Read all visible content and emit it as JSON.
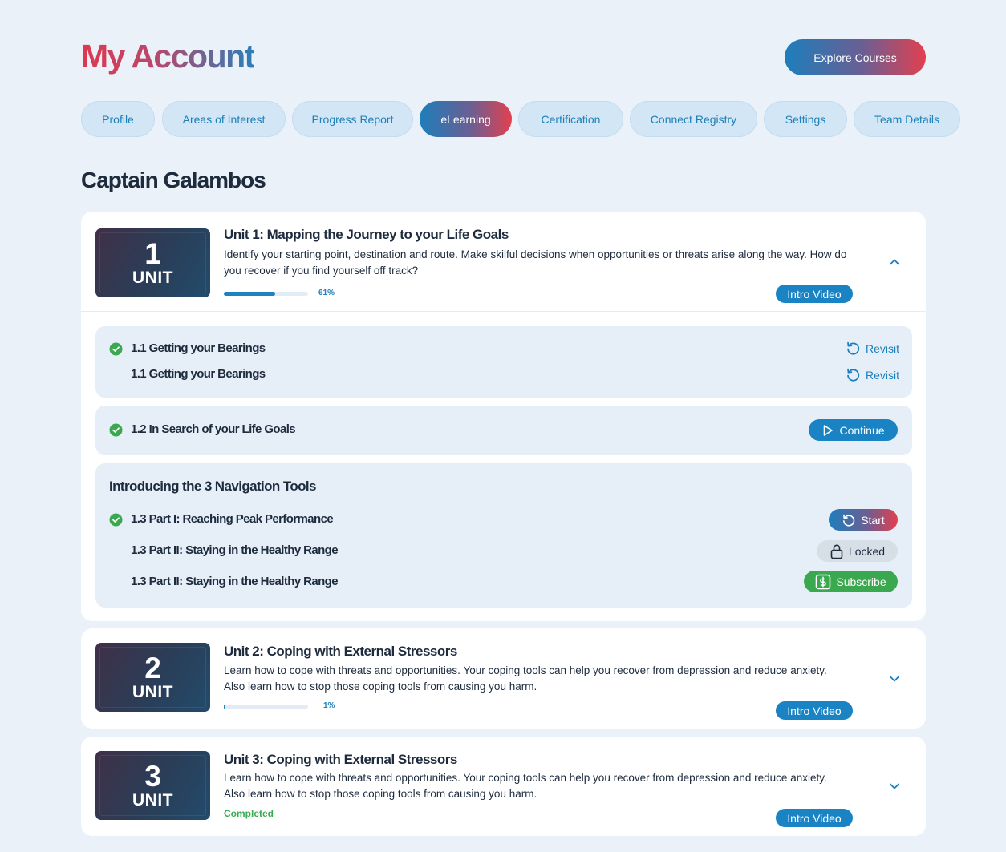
{
  "header": {
    "title": "My Account",
    "explore_label": "Explore Courses"
  },
  "tabs": [
    {
      "label": "Profile"
    },
    {
      "label": "Areas of Interest"
    },
    {
      "label": "Progress Report"
    },
    {
      "label": "eLearning",
      "active": true
    },
    {
      "label": "Certification"
    },
    {
      "label": "Connect Registry"
    },
    {
      "label": "Settings"
    },
    {
      "label": "Team Details"
    }
  ],
  "user": {
    "name": "Captain Galambos"
  },
  "units": [
    {
      "number": "1",
      "word": "UNIT",
      "title": "Unit 1: Mapping the Journey to your Life Goals",
      "description": "Identify your starting point, destination and route. Make skilful decisions when opportunities or threats arise along the way. How do you recover if you find yourself off track?",
      "progress_percent": 61,
      "progress_label": "61%",
      "intro_label": "Intro Video",
      "expanded": true,
      "chevron_icon": "chevron-up-icon"
    },
    {
      "number": "2",
      "word": "UNIT",
      "title": "Unit 2: Coping with External Stressors",
      "description": "Learn how to cope with threats and opportunities. Your coping tools can help you recover from depression and reduce anxiety. Also learn how to stop those coping tools from causing you harm.",
      "progress_percent": 1,
      "progress_label": "1%",
      "intro_label": "Intro Video",
      "expanded": false,
      "chevron_icon": "chevron-down-icon"
    },
    {
      "number": "3",
      "word": "UNIT",
      "title": "Unit 3: Coping with External Stressors",
      "description": "Learn how to cope with threats and opportunities. Your coping tools can help you recover from depression and reduce anxiety. Also learn how to stop those coping tools from causing you harm.",
      "status_label": "Completed",
      "intro_label": "Intro Video",
      "expanded": false,
      "chevron_icon": "chevron-down-icon"
    }
  ],
  "unit1_lessons": {
    "group1": [
      {
        "title": "1.1 Getting your Bearings",
        "completed": true,
        "action": "Revisit",
        "action_icon": "revisit-icon"
      },
      {
        "title": "1.1 Getting your Bearings",
        "completed": false,
        "action": "Revisit",
        "action_icon": "revisit-icon"
      }
    ],
    "group2": [
      {
        "title": "1.2 In Search of your Life Goals",
        "completed": true,
        "action": "Continue",
        "action_icon": "play-icon"
      }
    ],
    "group3": {
      "heading": "Introducing the 3 Navigation Tools",
      "items": [
        {
          "title": "1.3 Part I: Reaching Peak Performance",
          "completed": true,
          "action": "Start",
          "action_icon": "revisit-icon"
        },
        {
          "title": "1.3 Part II: Staying in the Healthy Range",
          "completed": false,
          "action": "Locked",
          "action_icon": "lock-icon"
        },
        {
          "title": "1.3 Part II: Staying in the Healthy Range",
          "completed": false,
          "action": "Subscribe",
          "action_icon": "dollar-icon"
        }
      ]
    }
  },
  "colors": {
    "background": "#eaf1f8",
    "accent_blue": "#1a83c3",
    "accent_red": "#e2404f",
    "success_green": "#3aa84e",
    "text_dark": "#1d2b3d"
  }
}
